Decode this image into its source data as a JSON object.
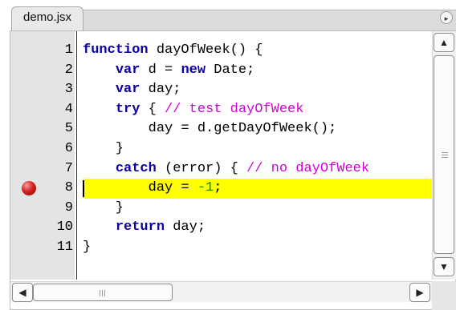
{
  "tab": {
    "label": "demo.jsx",
    "menu_icon": "tab-menu-icon"
  },
  "editor": {
    "lines": [
      {
        "num": "1",
        "tokens": [
          {
            "t": "function",
            "c": "kw"
          },
          {
            "t": " dayOfWeek() {",
            "c": "pl"
          }
        ]
      },
      {
        "num": "2",
        "tokens": [
          {
            "t": "    ",
            "c": "pl"
          },
          {
            "t": "var",
            "c": "kw"
          },
          {
            "t": " d = ",
            "c": "pl"
          },
          {
            "t": "new",
            "c": "kw"
          },
          {
            "t": " Date;",
            "c": "pl"
          }
        ]
      },
      {
        "num": "3",
        "tokens": [
          {
            "t": "    ",
            "c": "pl"
          },
          {
            "t": "var",
            "c": "kw"
          },
          {
            "t": " day;",
            "c": "pl"
          }
        ]
      },
      {
        "num": "4",
        "tokens": [
          {
            "t": "    ",
            "c": "pl"
          },
          {
            "t": "try",
            "c": "kw"
          },
          {
            "t": " { ",
            "c": "pl"
          },
          {
            "t": "// test dayOfWeek",
            "c": "cm"
          }
        ]
      },
      {
        "num": "5",
        "tokens": [
          {
            "t": "        day = d.getDayOfWeek();",
            "c": "pl"
          }
        ]
      },
      {
        "num": "6",
        "tokens": [
          {
            "t": "    }",
            "c": "pl"
          }
        ]
      },
      {
        "num": "7",
        "tokens": [
          {
            "t": "    ",
            "c": "pl"
          },
          {
            "t": "catch",
            "c": "kw"
          },
          {
            "t": " (error) { ",
            "c": "pl"
          },
          {
            "t": "// no dayOfWeek",
            "c": "cm"
          }
        ]
      },
      {
        "num": "8",
        "breakpoint": true,
        "highlight": true,
        "tokens": [
          {
            "t": "        day = ",
            "c": "pl"
          },
          {
            "t": "-1",
            "c": "num"
          },
          {
            "t": ";",
            "c": "pl"
          }
        ]
      },
      {
        "num": "9",
        "tokens": [
          {
            "t": "    }",
            "c": "pl"
          }
        ]
      },
      {
        "num": "10",
        "tokens": [
          {
            "t": "    ",
            "c": "pl"
          },
          {
            "t": "return",
            "c": "kw"
          },
          {
            "t": " day;",
            "c": "pl"
          }
        ]
      },
      {
        "num": "11",
        "tokens": [
          {
            "t": "}",
            "c": "pl"
          }
        ]
      }
    ]
  },
  "colors": {
    "keyword": "#0b00a6",
    "comment": "#d600d6",
    "number": "#009000",
    "highlight": "#ffff00",
    "breakpoint": "#d82020",
    "gutter": "#e4e4e4"
  },
  "scrollbars": {
    "up_icon": "▲",
    "down_icon": "▼",
    "left_icon": "◀",
    "right_icon": "▶"
  }
}
